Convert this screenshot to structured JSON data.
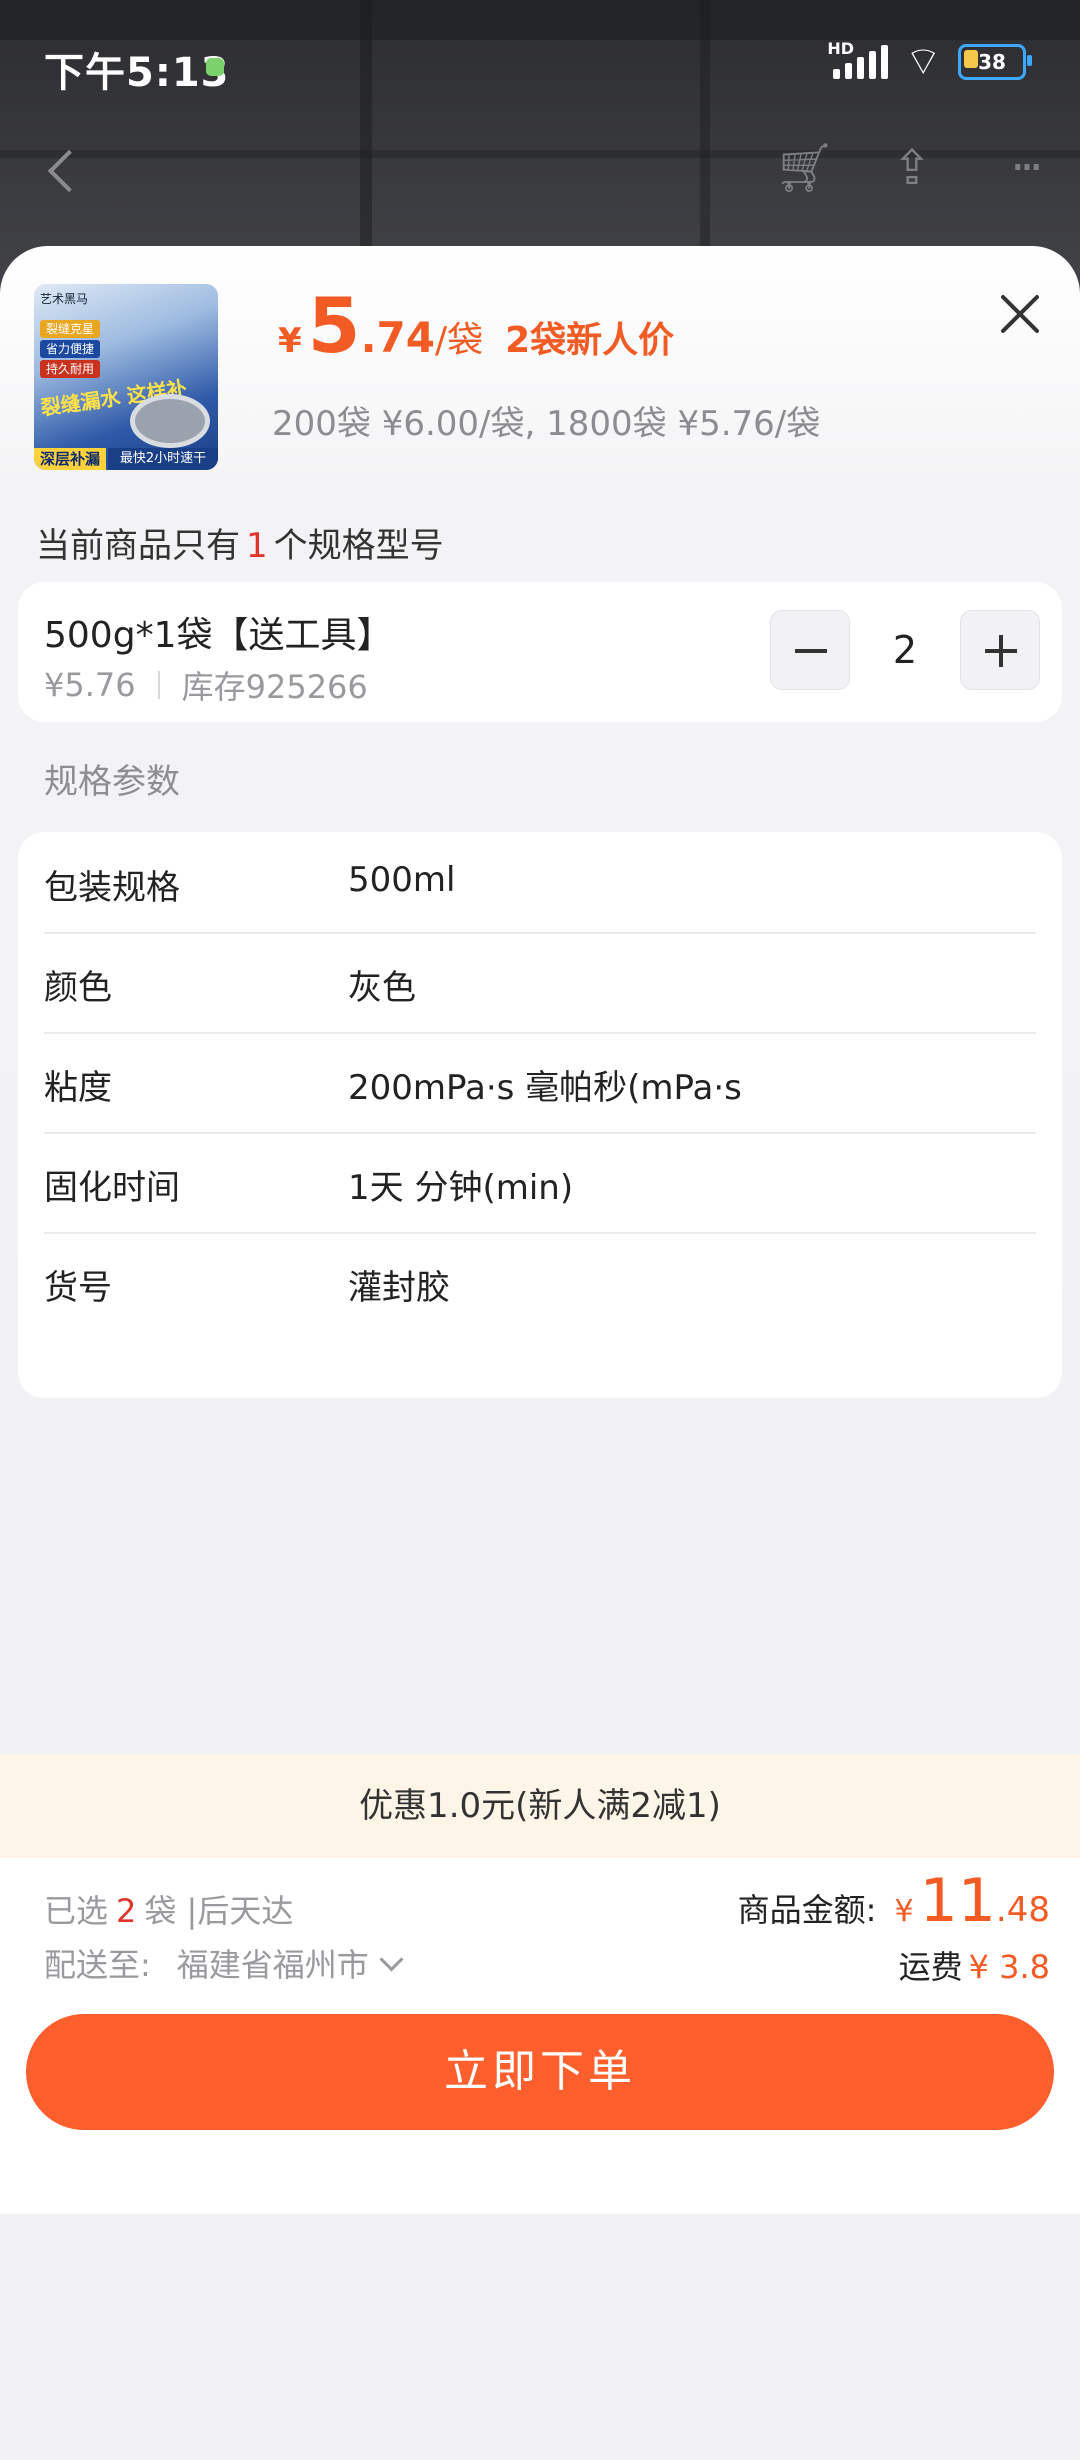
{
  "status_bar": {
    "time": "下午5:13",
    "network": "HD",
    "battery": "38"
  },
  "nav": {
    "back_icon": "back-chevron-icon",
    "cart_icon": "cart-icon",
    "share_icon": "share-icon",
    "more_icon": "more-dots-icon"
  },
  "product": {
    "thumb_brand": "艺术黑马",
    "thumb_tags": [
      "裂缝克星",
      "省力便捷",
      "持久耐用"
    ],
    "thumb_big": "裂缝漏水 这样补",
    "thumb_bar_left": "深层补漏",
    "thumb_bar_right": "最快2小时速干",
    "currency": "¥",
    "price_int": "5",
    "price_dec": ".74",
    "price_unit": "/袋",
    "promo": "2袋新人价",
    "tier_prices": "200袋 ¥6.00/袋, 1800袋 ¥5.76/袋"
  },
  "spec": {
    "count_prefix": "当前商品只有",
    "count": "1",
    "count_suffix": "个规格型号"
  },
  "sku": {
    "name": "500g*1袋【送工具】",
    "price": "¥5.76",
    "stock": "库存925266",
    "quantity": "2"
  },
  "params": {
    "title": "规格参数",
    "rows": [
      {
        "key": "包装规格",
        "value": "500ml"
      },
      {
        "key": "颜色",
        "value": "灰色"
      },
      {
        "key": "粘度",
        "value": "200mPa·s 毫帕秒(mPa·s"
      },
      {
        "key": "固化时间",
        "value": "1天 分钟(min)"
      },
      {
        "key": "货号",
        "value": "灌封胶"
      }
    ]
  },
  "footer": {
    "discount": "优惠1.0元(新人满2减1)",
    "selected_prefix": "已选",
    "selected_count": "2",
    "selected_suffix": "袋 |后天达",
    "ship_label": "配送至:",
    "ship_addr": "福建省福州市",
    "total_label": "商品金额:",
    "total_currency": "¥",
    "total_int": "11",
    "total_dec": ".48",
    "freight_label": "运费",
    "freight_value": "¥ 3.8",
    "order_button": "立即下单"
  },
  "colors": {
    "accent": "#f25b24",
    "button": "#fe5f2c",
    "highlight": "#e0352b"
  }
}
